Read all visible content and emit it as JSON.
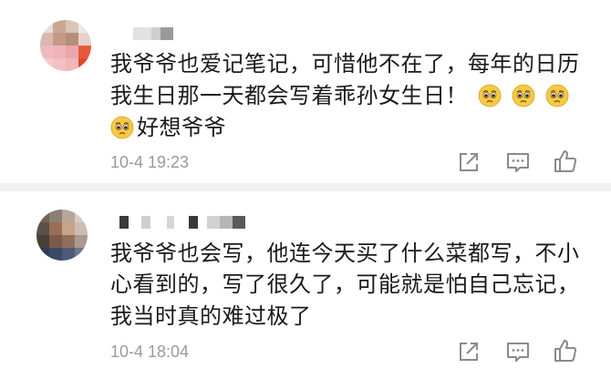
{
  "comments": [
    {
      "lines": [
        "我爷爷也爱记笔记，可惜他不在了，每年的日历",
        "我生日那一天都会写着乖孙女生日！",
        "好想爷爷"
      ],
      "time": "10-4 19:23"
    },
    {
      "lines": [
        "我爷爷也会写，他连今天买了什么菜都写，不小",
        "心看到的，写了很久了，可能就是怕自己忘记，",
        "我当时真的难过极了"
      ],
      "time": "10-4 18:04"
    }
  ],
  "icons": {
    "share": "share-icon",
    "comment": "comment-icon",
    "like": "like-icon",
    "emoji": "pleading-face-emoji"
  },
  "colors": {
    "text": "#1a1a1a",
    "meta": "#9a9a9a",
    "icon": "#8a8a8a",
    "emoji_face": "#f7c944"
  }
}
